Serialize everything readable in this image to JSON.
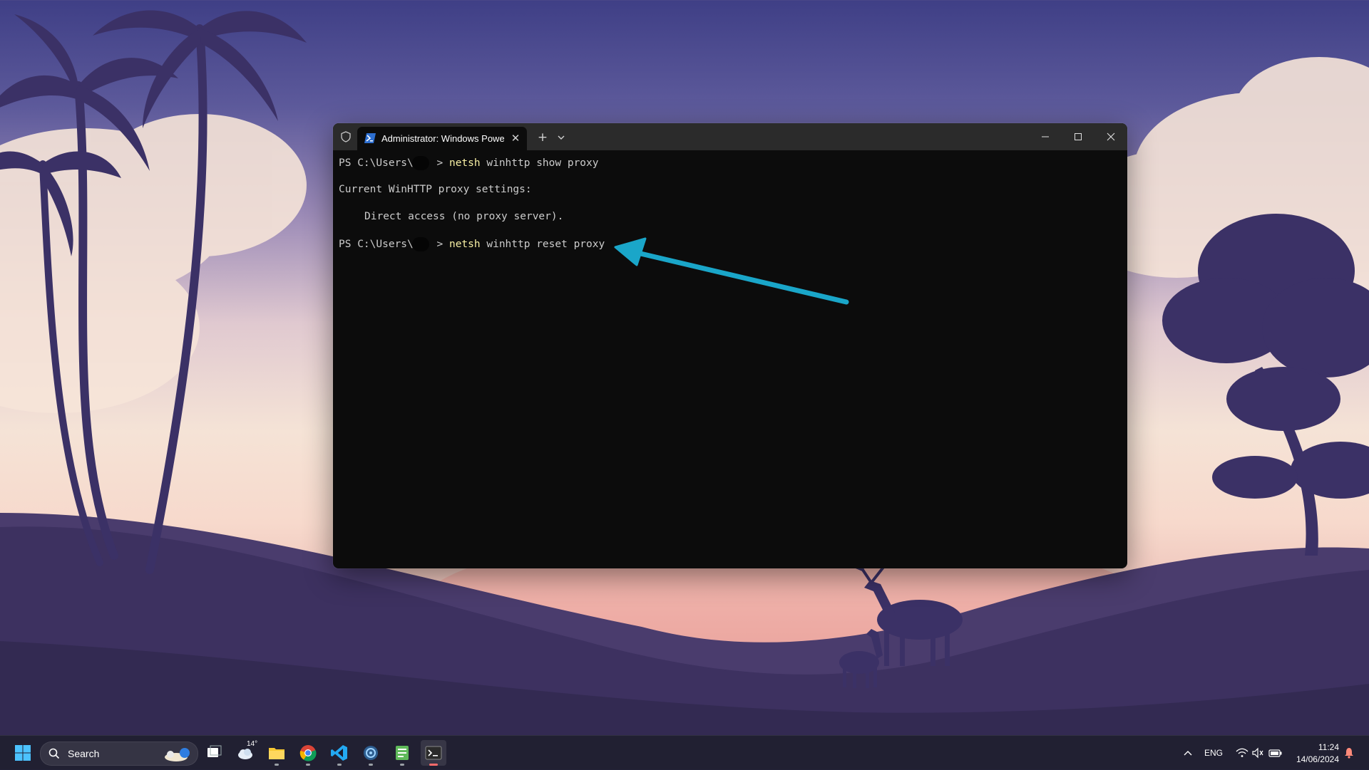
{
  "window": {
    "tab_title": "Administrator: Windows PowerShell",
    "tab_close_glyph": "✕",
    "new_tab_glyph": "+"
  },
  "console": {
    "line1_prompt": "PS C:\\Users\\",
    "line1_prompt_end": " > ",
    "line1_cmd": "netsh",
    "line1_args": " winhttp show proxy",
    "line2": "Current WinHTTP proxy settings:",
    "line3": "Direct access (no proxy server).",
    "line4_prompt": "PS C:\\Users\\",
    "line4_prompt_end": " > ",
    "line4_cmd": "netsh",
    "line4_args": " winhttp reset proxy"
  },
  "annotation": {
    "arrow_color": "#1aa6c9"
  },
  "taskbar": {
    "search_label": "Search",
    "weather_temp": "14°",
    "language": "ENG",
    "time": "11:24",
    "date": "14/06/2024"
  },
  "colors": {
    "terminal_bg": "#0c0c0c",
    "titlebar_bg": "#2b2b2b",
    "command_yellow": "#f9f1a5",
    "text_gray": "#cccccc"
  },
  "icons": [
    "shield-icon",
    "powershell-icon",
    "close-icon",
    "plus-icon",
    "chevron-down-icon",
    "minimize-icon",
    "maximize-icon",
    "windows-start-icon",
    "search-icon",
    "task-view-icon",
    "weather-icon",
    "file-explorer-icon",
    "chrome-icon",
    "vscode-icon",
    "network-app-icon",
    "notepad-icon",
    "terminal-icon",
    "chevron-up-icon",
    "wifi-icon",
    "speaker-muted-icon",
    "battery-icon",
    "notification-bell-icon"
  ]
}
